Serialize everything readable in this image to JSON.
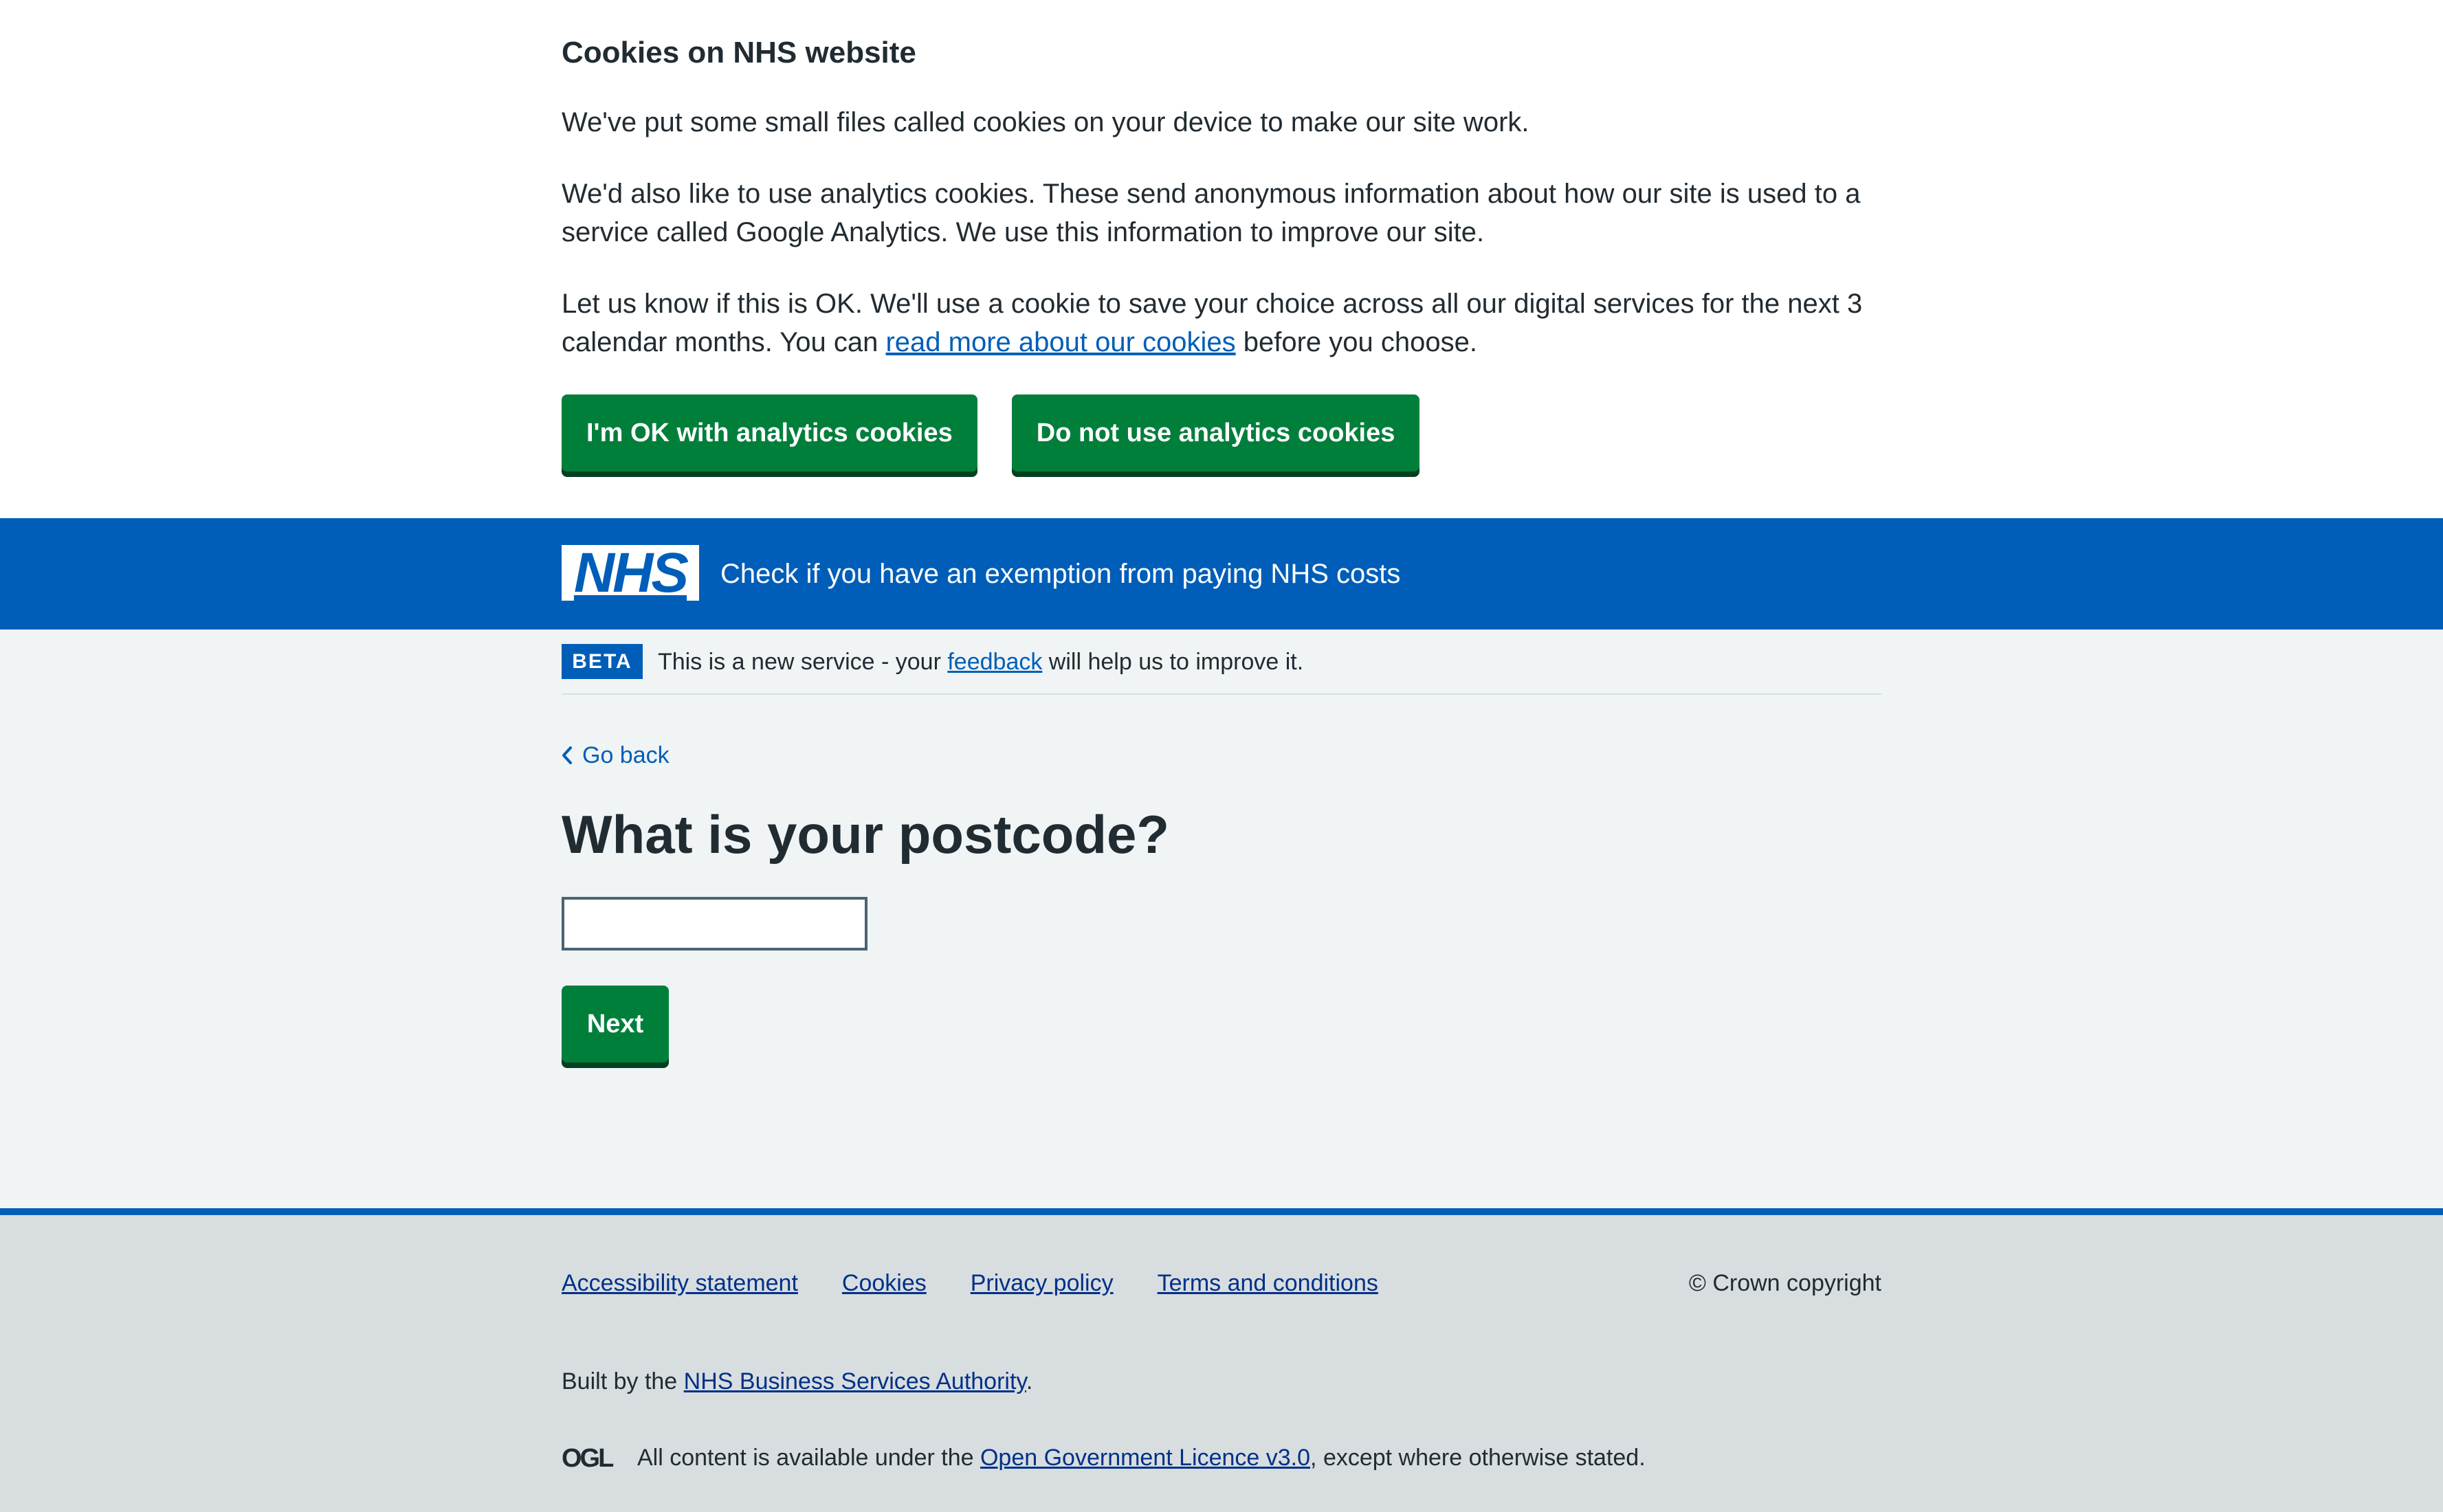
{
  "cookie_banner": {
    "heading": "Cookies on NHS website",
    "paragraph1": "We've put some small files called cookies on your device to make our site work.",
    "paragraph2": "We'd also like to use analytics cookies. These send anonymous information about how our site is used to a service called Google Analytics. We use this information to improve our site.",
    "paragraph3_before": "Let us know if this is OK. We'll use a cookie to save your choice across all our digital services for the next 3 calendar months. You can ",
    "paragraph3_link": "read more about our cookies",
    "paragraph3_after": " before you choose.",
    "accept_label": "I'm OK with analytics cookies",
    "reject_label": "Do not use analytics cookies"
  },
  "header": {
    "logo_text": "NHS",
    "service_name": "Check if you have an exemption from paying NHS costs"
  },
  "phase_banner": {
    "tag": "BETA",
    "text_before": "This is a new service - your ",
    "link": "feedback",
    "text_after": " will help us to improve it."
  },
  "main": {
    "back_label": "Go back",
    "title": "What is your postcode?",
    "postcode_value": "",
    "next_label": "Next"
  },
  "footer": {
    "links": [
      "Accessibility statement",
      "Cookies",
      "Privacy policy",
      "Terms and conditions"
    ],
    "copyright": "© Crown copyright",
    "built_before": "Built by the ",
    "built_link": "NHS Business Services Authority",
    "built_after": ".",
    "ogl_logo_text": "OGL",
    "licence_before": "All content is available under the ",
    "licence_link": "Open Government Licence v3.0",
    "licence_after": ", except where otherwise stated."
  },
  "colors": {
    "nhs_blue": "#005eb8",
    "button_green": "#007f3b",
    "button_shadow": "#00401e",
    "page_background": "#f0f4f5",
    "footer_background": "#d8dde0",
    "text": "#212b32"
  }
}
